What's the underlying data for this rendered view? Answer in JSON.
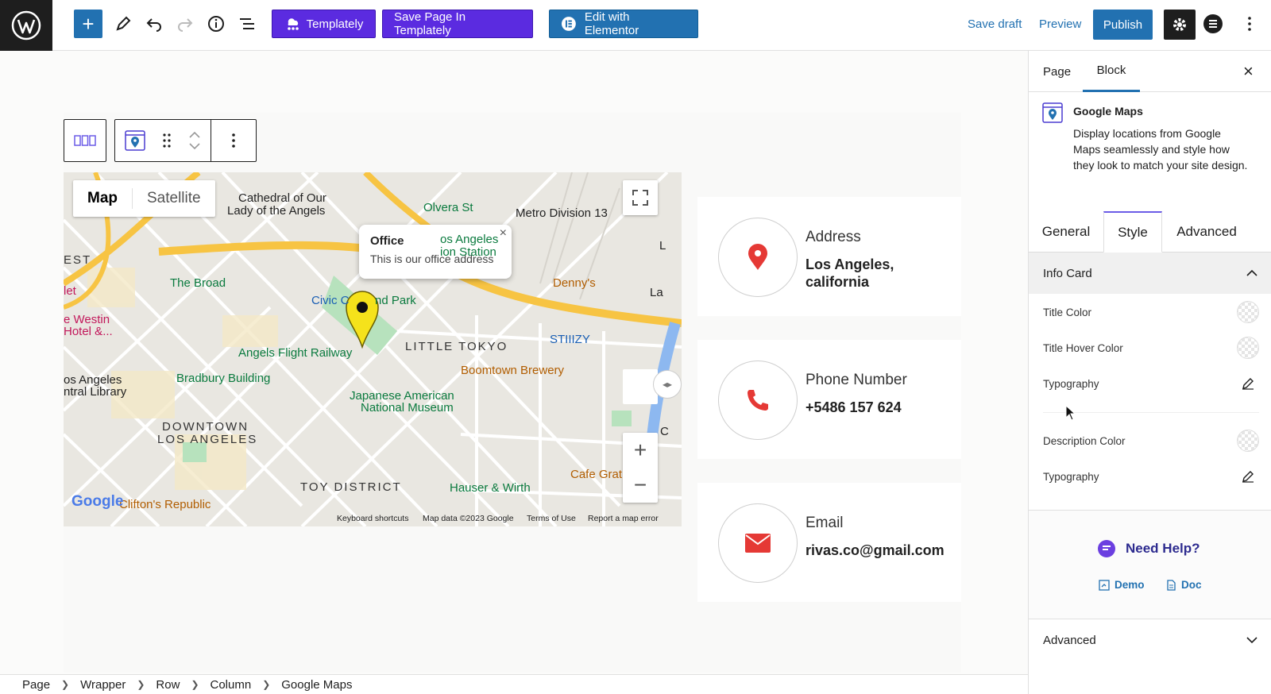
{
  "toolbar": {
    "templately_label": "Templately",
    "save_templately_label": "Save Page In Templately",
    "elementor_label": "Edit with Elementor",
    "save_draft_label": "Save draft",
    "preview_label": "Preview",
    "publish_label": "Publish"
  },
  "map": {
    "tab_map": "Map",
    "tab_satellite": "Satellite",
    "popup_title": "Office",
    "popup_desc": "This is our office address",
    "labels": {
      "cathedral": "Cathedral of Our",
      "cathedral2": "Lady of the Angels",
      "olvera": "Olvera St",
      "metro": "Metro Division 13",
      "la_station": "os Angeles",
      "la_station2": "ion Station",
      "broad": "The Broad",
      "civic": "Civic C",
      "grand_park": "nd Park",
      "dennys": "Denny's",
      "westin": "e Westin",
      "hotel": "Hotel &...",
      "little_tokyo": "LITTLE TOKYO",
      "stiizy": "STIIIZY",
      "angels_flight": "Angels Flight Railway",
      "bradbury": "Bradbury Building",
      "boomtown": "Boomtown Brewery",
      "la_library": "os Angeles",
      "la_library2": "ntral Library",
      "jan_museum": "Japanese American",
      "jan_museum2": "National Museum",
      "downtown": "DOWNTOWN",
      "downtown2": "LOS ANGELES",
      "toy_district": "TOY DISTRICT",
      "hauser": "Hauser & Wirth",
      "cafe": "Cafe Grat",
      "clifton": "Clifton's Republic",
      "est": "EST",
      "let": "let",
      "la_right": "La",
      "l_right": "L",
      "c_right": "C"
    },
    "footer_keyboard": "Keyboard shortcuts",
    "footer_data": "Map data ©2023 Google",
    "footer_terms": "Terms of Use",
    "footer_report": "Report a map error",
    "google_logo": "Google"
  },
  "cards": [
    {
      "title": "Address",
      "value": "Los Angeles, california"
    },
    {
      "title": "Phone Number",
      "value": "+5486 157 624"
    },
    {
      "title": "Email",
      "value": "rivas.co@gmail.com"
    }
  ],
  "breadcrumb": [
    "Page",
    "Wrapper",
    "Row",
    "Column",
    "Google Maps"
  ],
  "sidebar": {
    "tab_page": "Page",
    "tab_block": "Block",
    "block_name": "Google Maps",
    "block_desc": "Display locations from Google Maps seamlessly and style how they look to match your site design.",
    "inner_tabs": [
      "General",
      "Style",
      "Advanced"
    ],
    "panel_title": "Info Card",
    "rows": [
      "Title Color",
      "Title Hover Color",
      "Typography",
      "Description Color",
      "Typography"
    ],
    "help_title": "Need Help?",
    "demo_label": "Demo",
    "doc_label": "Doc",
    "advanced_label": "Advanced"
  },
  "colors": {
    "accent": "#2271b1",
    "templately": "#5b2be0",
    "card_icon": "#e53935",
    "pin": "#f5e21b"
  }
}
